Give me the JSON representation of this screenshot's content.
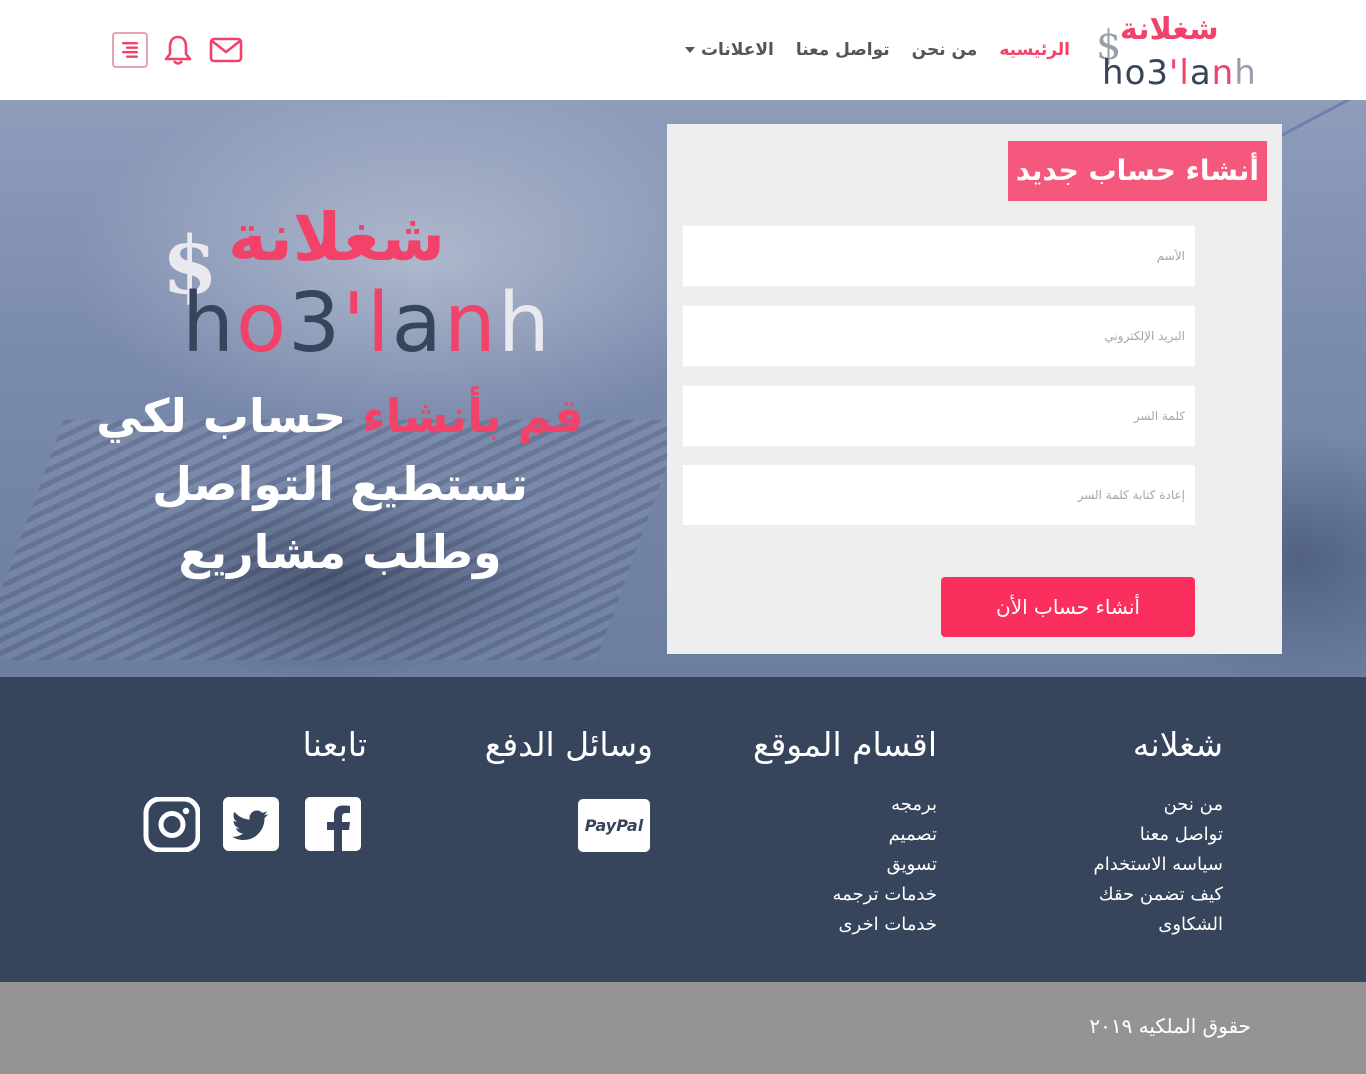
{
  "header": {
    "logo": {
      "arabic": "شغلانة",
      "dollar": "$",
      "english": [
        "h",
        "o",
        "3",
        "'",
        "l",
        "a",
        "n",
        "h"
      ]
    },
    "nav": [
      {
        "label": "الرئيسيه",
        "active": true
      },
      {
        "label": "من نحن",
        "active": false
      },
      {
        "label": "تواصل معنا",
        "active": false
      },
      {
        "label": "الاعلانات",
        "active": false,
        "dropdown": true
      }
    ],
    "icons": [
      "mail-icon",
      "bell-icon",
      "menu-icon"
    ]
  },
  "hero": {
    "logo": {
      "arabic": "شغلانة",
      "dollar": "$",
      "english": [
        "h",
        "o",
        "3",
        "'",
        "l",
        "a",
        "n",
        "h"
      ]
    },
    "headline_highlight": "قم بأنشاء",
    "headline_rest": "حساب لكي",
    "line2": "تستطيع التواصل",
    "line3": "وطلب مشاريع"
  },
  "signup": {
    "title": "أنشاء حساب جديد",
    "fields": [
      {
        "placeholder": "الأسم",
        "value": ""
      },
      {
        "placeholder": "البريد الإلكتروني",
        "value": ""
      },
      {
        "placeholder": "كلمة السر",
        "value": ""
      },
      {
        "placeholder": "إعادة كتابة كلمة السر",
        "value": ""
      }
    ],
    "submit_label": "أنشاء حساب الأن"
  },
  "footer": {
    "about": {
      "title": "شغلانه",
      "links": [
        "من نحن",
        "تواصل معنا",
        "سياسه الاستخدام",
        "كيف تضمن حقك",
        "الشكاوى"
      ]
    },
    "sections": {
      "title": "اقسام الموقع",
      "links": [
        "برمجه",
        "تصميم",
        "تسويق",
        "خدمات ترجمه",
        "خدمات اخرى"
      ]
    },
    "payment": {
      "title": "وسائل الدفع",
      "methods": [
        "PayPal"
      ]
    },
    "follow": {
      "title": "تابعنا",
      "icons": [
        "facebook-icon",
        "twitter-icon",
        "instagram-icon"
      ]
    }
  },
  "copyright": "حقوق الملكيه ٢٠١٩",
  "colors": {
    "accent": "#f2426a",
    "button": "#fb2f5e",
    "navy": "#36455c",
    "copyright_bg": "#959394",
    "card_bg": "#eeeeee"
  }
}
